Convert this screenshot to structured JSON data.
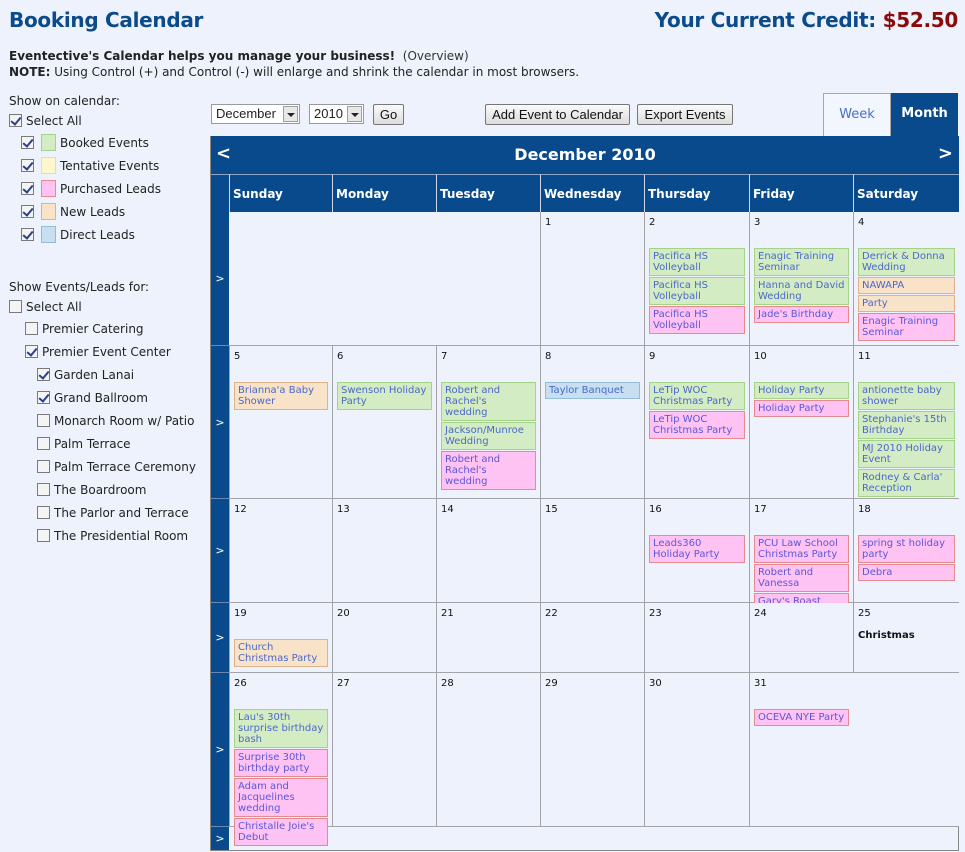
{
  "header": {
    "title": "Booking Calendar",
    "credit_label": "Your Current Credit:",
    "credit_amount": "$52.50",
    "intro_bold": "Eventective's Calendar helps you manage your business!",
    "intro_link": "(Overview)",
    "note_label": "NOTE:",
    "note_text": " Using Control (+) and Control (-) will enlarge and shrink the calendar in most browsers."
  },
  "colors": {
    "brand_blue": "#084a8c",
    "credit_red": "#8b0a0a",
    "booked": "#d4ecc4",
    "tentative": "#fff7cc",
    "purchased": "#ffc3f3",
    "new_lead": "#f8e2c8",
    "direct": "#c7dff0"
  },
  "sidebar": {
    "show_label": "Show on calendar:",
    "select_all": {
      "label": "Select All",
      "checked": true
    },
    "types": [
      {
        "label": "Booked Events",
        "checked": true,
        "color": "#d4ecc4",
        "border": "#a5d28a"
      },
      {
        "label": "Tentative Events",
        "checked": true,
        "color": "#fff7cc",
        "border": "#f0dd90"
      },
      {
        "label": "Purchased Leads",
        "checked": true,
        "color": "#ffc3f3",
        "border": "#e58a8f"
      },
      {
        "label": "New Leads",
        "checked": true,
        "color": "#f8e2c8",
        "border": "#deb38c"
      },
      {
        "label": "Direct Leads",
        "checked": true,
        "color": "#c7dff0",
        "border": "#95bcd6"
      }
    ],
    "for_label": "Show Events/Leads for:",
    "for_select_all": {
      "label": "Select All",
      "checked": false
    },
    "venues": [
      {
        "label": "Premier Catering",
        "checked": false,
        "level": 1
      },
      {
        "label": "Premier Event Center",
        "checked": true,
        "level": 1
      },
      {
        "label": "Garden Lanai",
        "checked": true,
        "level": 2
      },
      {
        "label": "Grand Ballroom",
        "checked": true,
        "level": 2
      },
      {
        "label": "Monarch Room w/ Patio",
        "checked": false,
        "level": 2
      },
      {
        "label": "Palm Terrace",
        "checked": false,
        "level": 2
      },
      {
        "label": "Palm Terrace Ceremony",
        "checked": false,
        "level": 2
      },
      {
        "label": "The Boardroom",
        "checked": false,
        "level": 2
      },
      {
        "label": "The Parlor and Terrace",
        "checked": false,
        "level": 2
      },
      {
        "label": "The Presidential Room",
        "checked": false,
        "level": 2
      }
    ]
  },
  "controls": {
    "month_select": "December",
    "year_select": "2010",
    "go_label": "Go",
    "add_event_label": "Add Event to Calendar",
    "export_label": "Export Events",
    "tab_week": "Week",
    "tab_month": "Month",
    "active_tab": "Month"
  },
  "calendar": {
    "month_title": "December 2010",
    "prev_label": "<",
    "next_label": ">",
    "week_expand_label": ">",
    "days": [
      "Sunday",
      "Monday",
      "Tuesday",
      "Wednesday",
      "Thursday",
      "Friday",
      "Saturday"
    ],
    "weeks": [
      [
        {
          "day": "",
          "events": []
        },
        {
          "day": "",
          "events": []
        },
        {
          "day": "",
          "events": []
        },
        {
          "day": "1",
          "events": []
        },
        {
          "day": "2",
          "events": [
            {
              "title": "Pacifica HS Volleyball",
              "type": "booked"
            },
            {
              "title": "Pacifica HS Volleyball",
              "type": "booked"
            },
            {
              "title": "Pacifica HS Volleyball",
              "type": "purchased"
            }
          ]
        },
        {
          "day": "3",
          "events": [
            {
              "title": "Enagic Training Seminar",
              "type": "booked"
            },
            {
              "title": "Hanna and David Wedding",
              "type": "booked"
            },
            {
              "title": "Jade's Birthday",
              "type": "purchased"
            }
          ]
        },
        {
          "day": "4",
          "events": [
            {
              "title": "Derrick & Donna Wedding",
              "type": "booked"
            },
            {
              "title": "NAWAPA",
              "type": "newlead"
            },
            {
              "title": "Party",
              "type": "newlead"
            },
            {
              "title": "Enagic Training Seminar",
              "type": "purchased"
            }
          ]
        }
      ],
      [
        {
          "day": "5",
          "events": [
            {
              "title": "Brianna'a Baby Shower",
              "type": "newlead"
            }
          ]
        },
        {
          "day": "6",
          "events": [
            {
              "title": "Swenson Holiday Party",
              "type": "booked"
            }
          ]
        },
        {
          "day": "7",
          "events": [
            {
              "title": "Robert and Rachel's wedding",
              "type": "booked"
            },
            {
              "title": "Jackson/Munroe Wedding",
              "type": "booked"
            },
            {
              "title": "Robert and Rachel's wedding",
              "type": "purchased"
            }
          ]
        },
        {
          "day": "8",
          "events": [
            {
              "title": "Taylor Banquet",
              "type": "direct"
            }
          ]
        },
        {
          "day": "9",
          "events": [
            {
              "title": "LeTip WOC Christmas Party",
              "type": "booked"
            },
            {
              "title": "LeTip WOC Christmas Party",
              "type": "purchased"
            }
          ]
        },
        {
          "day": "10",
          "events": [
            {
              "title": "Holiday Party",
              "type": "booked"
            },
            {
              "title": "Holiday Party",
              "type": "purchased"
            }
          ]
        },
        {
          "day": "11",
          "events": [
            {
              "title": "antionette baby shower",
              "type": "booked"
            },
            {
              "title": "Stephanie's 15th Birthday",
              "type": "booked"
            },
            {
              "title": "MJ 2010 Holiday Event",
              "type": "booked"
            },
            {
              "title": "Rodney & Carla' Reception",
              "type": "booked"
            }
          ]
        }
      ],
      [
        {
          "day": "12",
          "events": []
        },
        {
          "day": "13",
          "events": []
        },
        {
          "day": "14",
          "events": []
        },
        {
          "day": "15",
          "events": []
        },
        {
          "day": "16",
          "events": [
            {
              "title": "Leads360 Holiday Party",
              "type": "purchased"
            }
          ]
        },
        {
          "day": "17",
          "events": [
            {
              "title": "PCU Law School Christmas Party",
              "type": "purchased"
            },
            {
              "title": "Robert and Vanessa",
              "type": "purchased"
            },
            {
              "title": "Gary's Roast",
              "type": "purchased"
            }
          ]
        },
        {
          "day": "18",
          "events": [
            {
              "title": "spring st holiday party",
              "type": "purchased"
            },
            {
              "title": "Debra",
              "type": "purchased"
            }
          ]
        }
      ],
      [
        {
          "day": "19",
          "events": [
            {
              "title": "Church Christmas Party",
              "type": "newlead"
            }
          ]
        },
        {
          "day": "20",
          "events": []
        },
        {
          "day": "21",
          "events": []
        },
        {
          "day": "22",
          "events": []
        },
        {
          "day": "23",
          "events": []
        },
        {
          "day": "24",
          "events": []
        },
        {
          "day": "25",
          "holiday": "Christmas",
          "events": []
        }
      ],
      [
        {
          "day": "26",
          "events": [
            {
              "title": "Lau's 30th surprise birthday bash",
              "type": "booked"
            },
            {
              "title": "Surprise 30th birthday party",
              "type": "purchased"
            },
            {
              "title": "Adam and Jacquelines wedding",
              "type": "purchased"
            },
            {
              "title": "Christalle Joie's Debut",
              "type": "purchased"
            }
          ]
        },
        {
          "day": "27",
          "events": []
        },
        {
          "day": "28",
          "events": []
        },
        {
          "day": "29",
          "events": []
        },
        {
          "day": "30",
          "events": []
        },
        {
          "day": "31",
          "events": [
            {
              "title": "OCEVA NYE Party",
              "type": "purchased"
            }
          ]
        },
        {
          "day": "",
          "events": []
        }
      ],
      []
    ]
  }
}
